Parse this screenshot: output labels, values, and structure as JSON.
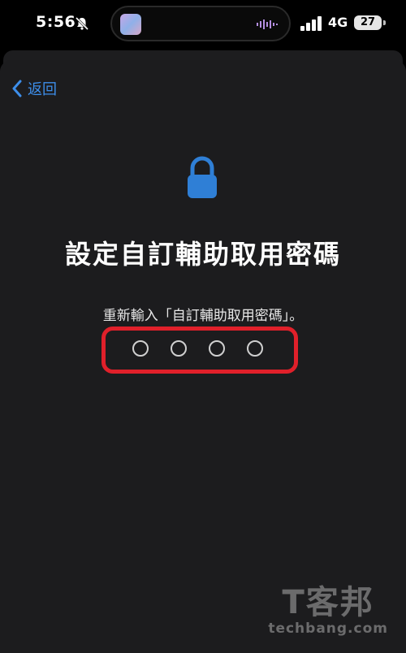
{
  "status_bar": {
    "time": "5:56",
    "network": "4G",
    "battery": "27",
    "icons": [
      "bell-slash-icon",
      "cellular-signal-icon",
      "battery-icon"
    ]
  },
  "nav": {
    "back_label": "返回",
    "back_icon": "chevron-left-icon"
  },
  "content": {
    "lock_icon": "lock-icon",
    "title": "設定自訂輔助取用密碼",
    "subtitle": "重新輸入「自訂輔助取用密碼」。",
    "passcode_digits": 4,
    "passcode_entered": 0
  },
  "colors": {
    "accent": "#3d8eea",
    "highlight": "#e0202a",
    "background": "#1c1c1e"
  },
  "watermark": {
    "logo": "T客邦",
    "site": "techbang.com"
  }
}
